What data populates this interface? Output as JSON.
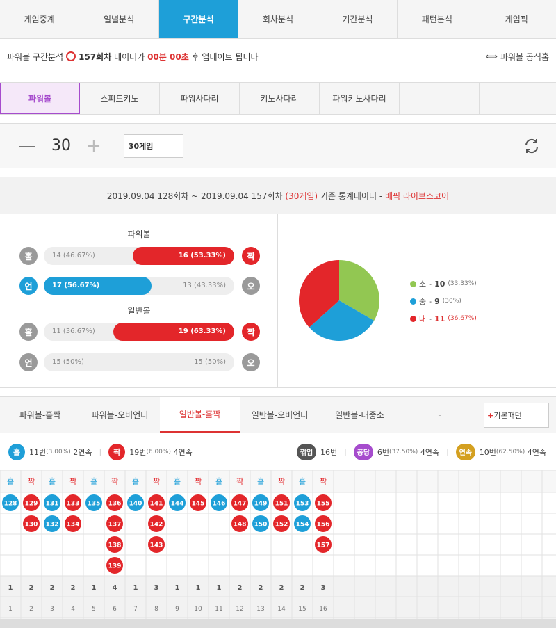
{
  "topnav": {
    "tabs": [
      "게임중계",
      "일별분석",
      "구간분석",
      "회차분석",
      "기간분석",
      "패턴분석",
      "게임픽"
    ],
    "active": 2
  },
  "update": {
    "game": "파워볼 구간분석",
    "round": "157회차",
    "text1": "데이터가",
    "time": "00분 00초",
    "text2": "후 업데이트 됩니다",
    "home_link": "파워볼 공식홈"
  },
  "gametabs": {
    "tabs": [
      "파워볼",
      "스피드키노",
      "파워사다리",
      "키노사다리",
      "파워키노사다리",
      "-",
      "-"
    ],
    "active": 0
  },
  "counter": {
    "minus": "—",
    "value": "30",
    "plus": "+",
    "select": "30게임"
  },
  "stats_header": {
    "range": "2019.09.04 128회차 ~ 2019.09.04 157회차",
    "games": "(30게임)",
    "basis": "기준 통계데이터 -",
    "brand": "베픽 라이브스코어"
  },
  "powerball": {
    "title": "파워볼",
    "oddeven": {
      "left_label": "홀",
      "left_text": "14 (46.67%)",
      "right_label": "짝",
      "right_text": "16 (53.33%)",
      "right_frac": 0.5333
    },
    "underover": {
      "left_label": "언",
      "left_text": "17 (56.67%)",
      "right_label": "오",
      "right_text": "13 (43.33%)",
      "left_frac": 0.5667
    }
  },
  "normalball": {
    "title": "일반볼",
    "oddeven": {
      "left_label": "홀",
      "left_text": "11 (36.67%)",
      "right_label": "짝",
      "right_text": "19 (63.33%)",
      "right_frac": 0.6333
    },
    "underover": {
      "left_label": "언",
      "left_text": "15 (50%)",
      "right_label": "오",
      "right_text": "15 (50%)"
    }
  },
  "pie": {
    "slices": [
      {
        "label": "소",
        "value": 10,
        "pct": "(33.33%)",
        "color": "#92c752"
      },
      {
        "label": "중",
        "value": 9,
        "pct": "(30%)",
        "color": "#1e9fd8"
      },
      {
        "label": "대",
        "value": 11,
        "pct": "(36.67%)",
        "color": "#e3262a"
      }
    ],
    "sep": "-"
  },
  "pattabs": {
    "tabs": [
      "파워볼-홀짝",
      "파워볼-오버언더",
      "일반볼-홀짝",
      "일반볼-오버언더",
      "일반볼-대중소",
      "-"
    ],
    "active": 2,
    "basic_plus": "+",
    "basic_label": "기본패턴"
  },
  "summary": {
    "odd": {
      "label": "홀",
      "count": "11번",
      "pct": "(3.00%)",
      "streak": "2연속"
    },
    "even": {
      "label": "짝",
      "count": "19번",
      "pct": "(6.00%)",
      "streak": "4연속"
    },
    "kkeok": {
      "label": "꺾임",
      "count": "16번"
    },
    "pong": {
      "label": "퐁당",
      "count": "6번",
      "pct": "(37.50%)",
      "streak": "4연속"
    },
    "yeon": {
      "label": "연속",
      "count": "10번",
      "pct": "(62.50%)",
      "streak": "4연속"
    }
  },
  "pattern": {
    "columns": [
      {
        "head": "홀",
        "type": "odd",
        "nums": [
          "128"
        ]
      },
      {
        "head": "짝",
        "type": "even",
        "nums": [
          "129",
          "130"
        ]
      },
      {
        "head": "홀",
        "type": "odd",
        "nums": [
          "131",
          "132"
        ]
      },
      {
        "head": "짝",
        "type": "even",
        "nums": [
          "133",
          "134"
        ]
      },
      {
        "head": "홀",
        "type": "odd",
        "nums": [
          "135"
        ]
      },
      {
        "head": "짝",
        "type": "even",
        "nums": [
          "136",
          "137",
          "138",
          "139"
        ]
      },
      {
        "head": "홀",
        "type": "odd",
        "nums": [
          "140"
        ]
      },
      {
        "head": "짝",
        "type": "even",
        "nums": [
          "141",
          "142",
          "143"
        ]
      },
      {
        "head": "홀",
        "type": "odd",
        "nums": [
          "144"
        ]
      },
      {
        "head": "짝",
        "type": "even",
        "nums": [
          "145"
        ]
      },
      {
        "head": "홀",
        "type": "odd",
        "nums": [
          "146"
        ]
      },
      {
        "head": "짝",
        "type": "even",
        "nums": [
          "147",
          "148"
        ]
      },
      {
        "head": "홀",
        "type": "odd",
        "nums": [
          "149",
          "150"
        ]
      },
      {
        "head": "짝",
        "type": "even",
        "nums": [
          "151",
          "152"
        ]
      },
      {
        "head": "홀",
        "type": "odd",
        "nums": [
          "153",
          "154"
        ]
      },
      {
        "head": "짝",
        "type": "even",
        "nums": [
          "155",
          "156",
          "157"
        ]
      }
    ],
    "counts": [
      "1",
      "2",
      "2",
      "2",
      "1",
      "4",
      "1",
      "3",
      "1",
      "1",
      "1",
      "2",
      "2",
      "2",
      "2",
      "3"
    ],
    "indexes": [
      "1",
      "2",
      "3",
      "4",
      "5",
      "6",
      "7",
      "8",
      "9",
      "10",
      "11",
      "12",
      "13",
      "14",
      "15",
      "16"
    ]
  },
  "colors": {
    "odd": "#1e9fd8",
    "even": "#e3262a",
    "accent": "#1e9fd8",
    "purple": "#a64ccd"
  }
}
